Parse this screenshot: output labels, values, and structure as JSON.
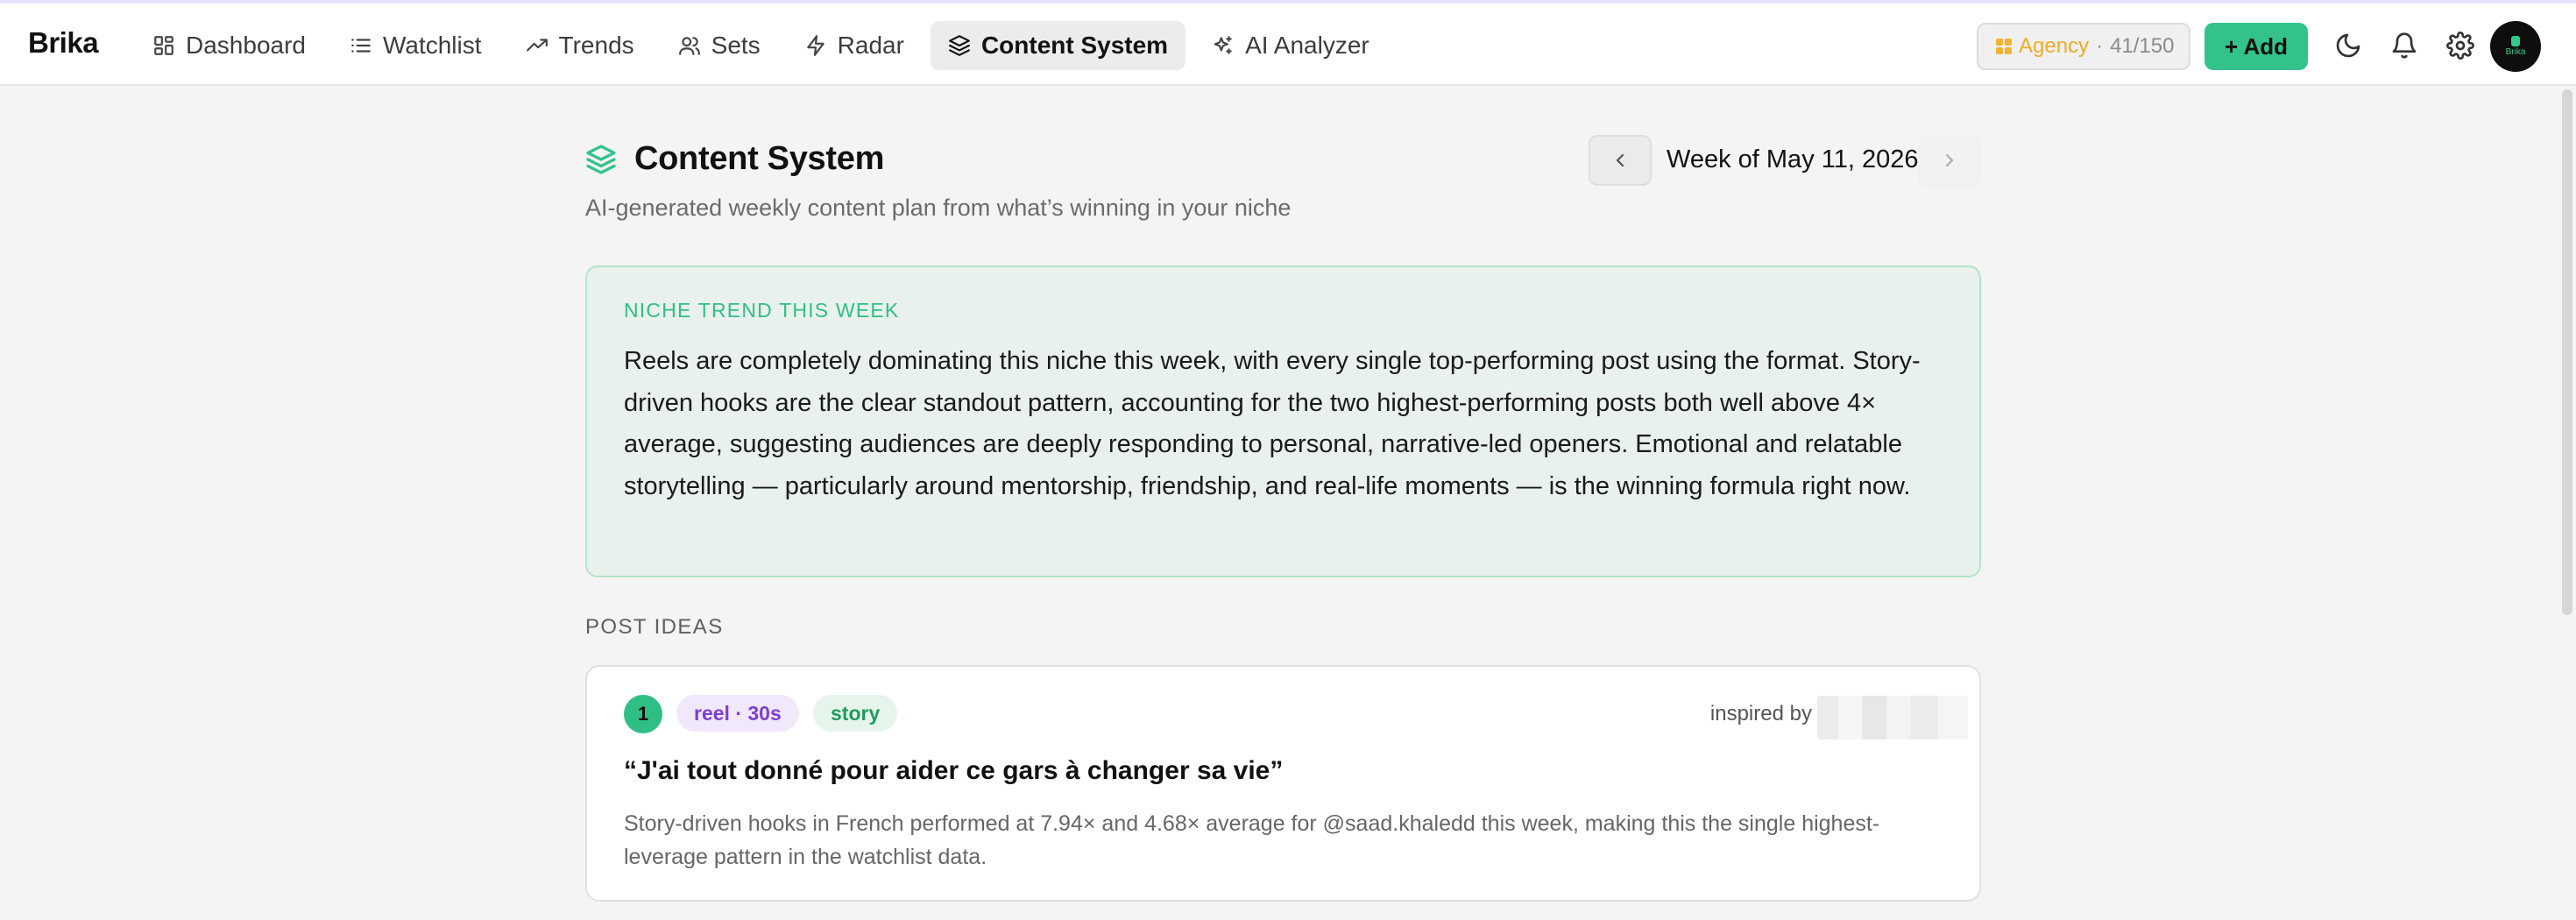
{
  "app": {
    "brand": "Brika"
  },
  "nav": {
    "items": [
      {
        "label": "Dashboard",
        "icon": "grid-icon"
      },
      {
        "label": "Watchlist",
        "icon": "list-icon"
      },
      {
        "label": "Trends",
        "icon": "trending-up-icon"
      },
      {
        "label": "Sets",
        "icon": "users-icon"
      },
      {
        "label": "Radar",
        "icon": "zap-icon"
      },
      {
        "label": "Content System",
        "icon": "layers-icon",
        "active": true
      },
      {
        "label": "AI Analyzer",
        "icon": "sparkles-icon"
      }
    ]
  },
  "toolbar": {
    "plan_name": "Agency",
    "plan_separator": "·",
    "plan_usage": "41/150",
    "add_label": "+ Add",
    "avatar_text": "Brika"
  },
  "page": {
    "title": "Content System",
    "subtitle": "AI-generated weekly content plan from what’s winning in your niche",
    "week_label": "Week of May 11, 2026"
  },
  "trend": {
    "heading": "NICHE TREND THIS WEEK",
    "body": "Reels are completely dominating this niche this week, with every single top-performing post using the format. Story-driven hooks are the clear standout pattern, accounting for the two highest-performing posts both well above 4× average, suggesting audiences are deeply responding to personal, narrative-led openers. Emotional and relatable storytelling — particularly around mentorship, friendship, and real-life moments — is the winning formula right now."
  },
  "post_ideas": {
    "label": "POST IDEAS",
    "items": [
      {
        "number": "1",
        "format": "reel · 30s",
        "type": "story",
        "inspired_by": "inspired by @",
        "title": "“J'ai tout donné pour aider ce gars à changer sa vie”",
        "description": "Story-driven hooks in French performed at 7.94× and 4.68× average for @saad.khaledd this week, making this the single highest-leverage pattern in the watchlist data."
      }
    ]
  },
  "colors": {
    "accent": "#33c38a",
    "plan": "#f0ab26",
    "reel_tag": "#7e3fd0",
    "story_tag": "#1f9a5a"
  }
}
